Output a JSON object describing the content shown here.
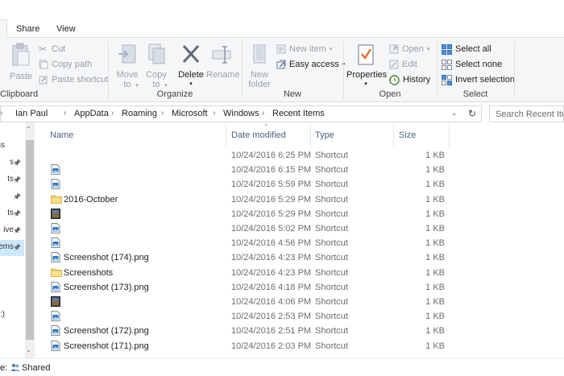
{
  "tabs": [
    "Share",
    "View"
  ],
  "ribbon": {
    "clipboard": {
      "paste": "Paste",
      "cut": "Cut",
      "copy_path": "Copy path",
      "paste_shortcut": "Paste shortcut",
      "label": "Clipboard"
    },
    "organize": {
      "move_to": "Move\nto",
      "copy_to": "Copy\nto",
      "delete": "Delete",
      "rename": "Rename",
      "label": "Organize"
    },
    "new": {
      "new_folder": "New\nfolder",
      "new_item": "New item",
      "easy_access": "Easy access",
      "label": "New"
    },
    "open": {
      "properties": "Properties",
      "open": "Open",
      "edit": "Edit",
      "history": "History",
      "label": "Open"
    },
    "select": {
      "select_all": "Select all",
      "select_none": "Select none",
      "invert_selection": "Invert selection",
      "label": "Select"
    }
  },
  "breadcrumb": [
    "Ian Paul",
    "AppData",
    "Roaming",
    "Microsoft",
    "Windows",
    "Recent Items"
  ],
  "search_placeholder": "Search Recent Items",
  "columns": {
    "name": "Name",
    "date": "Date modified",
    "type": "Type",
    "size": "Size"
  },
  "nav_items": [
    {
      "text": "ss",
      "pin": false
    },
    {
      "text": "s",
      "pin": true
    },
    {
      "text": "ts",
      "pin": true
    },
    {
      "text": "",
      "pin": true
    },
    {
      "text": "ts",
      "pin": true
    },
    {
      "text": "ive",
      "pin": true
    },
    {
      "text": "ems",
      "pin": true,
      "selected": true
    },
    {
      "text": "",
      "pin": false
    },
    {
      "text": "",
      "pin": false
    },
    {
      "text": "",
      "pin": false
    },
    {
      "text": ":)",
      "pin": false
    }
  ],
  "files": [
    {
      "name": "",
      "date": "10/24/2016 6:25 PM",
      "type": "Shortcut",
      "size": "1 KB",
      "icon": "blank-icon"
    },
    {
      "name": "",
      "date": "10/24/2016 6:15 PM",
      "type": "Shortcut",
      "size": "1 KB",
      "icon": "image-icon"
    },
    {
      "name": "",
      "date": "10/24/2016 5:59 PM",
      "type": "Shortcut",
      "size": "1 KB",
      "icon": "image-icon"
    },
    {
      "name": "2016-October",
      "date": "10/24/2016 5:29 PM",
      "type": "Shortcut",
      "size": "1 KB",
      "icon": "folder-icon"
    },
    {
      "name": "",
      "date": "10/24/2016 5:29 PM",
      "type": "Shortcut",
      "size": "1 KB",
      "icon": "photo-icon"
    },
    {
      "name": "",
      "date": "10/24/2016 5:02 PM",
      "type": "Shortcut",
      "size": "1 KB",
      "icon": "image-icon"
    },
    {
      "name": "",
      "date": "10/24/2016 4:56 PM",
      "type": "Shortcut",
      "size": "1 KB",
      "icon": "image-icon"
    },
    {
      "name": "Screenshot (174).png",
      "date": "10/24/2016 4:23 PM",
      "type": "Shortcut",
      "size": "1 KB",
      "icon": "image-icon"
    },
    {
      "name": "Screenshots",
      "date": "10/24/2016 4:23 PM",
      "type": "Shortcut",
      "size": "1 KB",
      "icon": "folder-icon"
    },
    {
      "name": "Screenshot (173).png",
      "date": "10/24/2016 4:18 PM",
      "type": "Shortcut",
      "size": "1 KB",
      "icon": "image-icon"
    },
    {
      "name": "",
      "date": "10/24/2016 4:06 PM",
      "type": "Shortcut",
      "size": "1 KB",
      "icon": "photo-icon"
    },
    {
      "name": "",
      "date": "10/24/2016 2:53 PM",
      "type": "Shortcut",
      "size": "1 KB",
      "icon": "image-icon"
    },
    {
      "name": "Screenshot (172).png",
      "date": "10/24/2016 2:51 PM",
      "type": "Shortcut",
      "size": "1 KB",
      "icon": "image-icon"
    },
    {
      "name": "Screenshot (171).png",
      "date": "10/24/2016 2:03 PM",
      "type": "Shortcut",
      "size": "1 KB",
      "icon": "image-icon"
    }
  ],
  "status": {
    "prefix": "e:",
    "value": "Shared"
  },
  "colors": {
    "accent": "#0063b1",
    "header_text": "#4c607a",
    "secondary_text": "#6d6d6d",
    "folder": "#f8d775",
    "disabled": "#9aa0a6"
  }
}
